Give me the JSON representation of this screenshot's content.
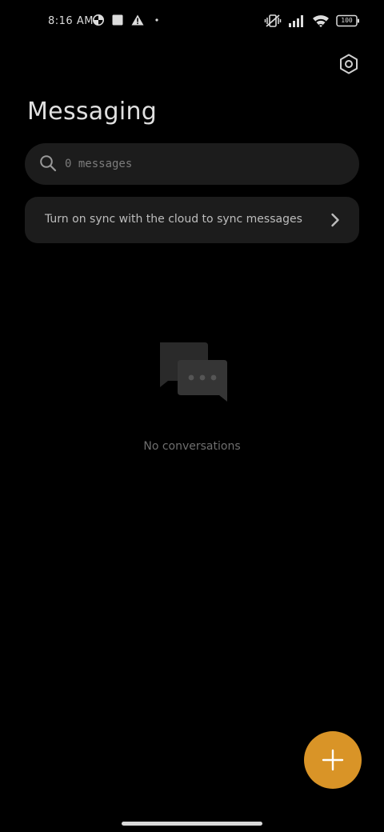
{
  "status_bar": {
    "time": "8:16 AM",
    "battery": "100",
    "left_icons": [
      "pie-status-icon",
      "square-notification-icon",
      "warning-icon",
      "dot-icon"
    ],
    "right_icons": [
      "vibrate-muted-icon",
      "signal-icon",
      "wifi-icon",
      "battery-icon"
    ]
  },
  "header": {
    "title": "Messaging",
    "settings_icon": "gear-icon"
  },
  "search": {
    "placeholder": "0 messages",
    "value": ""
  },
  "sync_banner": {
    "text": "Turn on sync with the cloud to sync messages"
  },
  "empty_state": {
    "icon": "chat-bubbles-icon",
    "text": "No conversations"
  },
  "fab": {
    "icon": "plus-icon"
  },
  "colors": {
    "background": "#000000",
    "surface": "#1c1c1c",
    "accent": "#d99427"
  }
}
